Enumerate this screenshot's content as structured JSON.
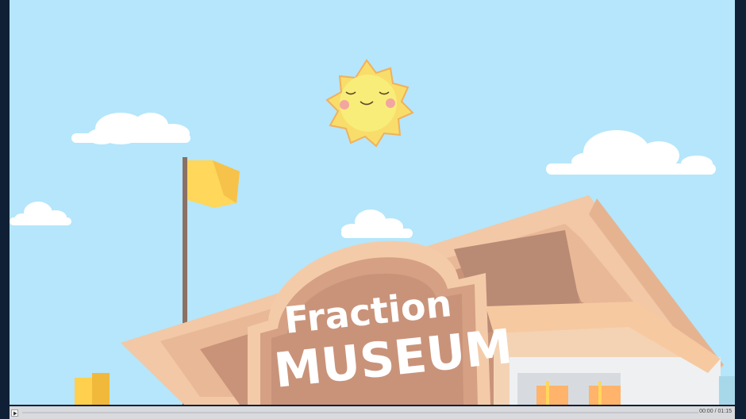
{
  "video": {
    "museum_sign": {
      "line1": "Fraction",
      "line2": "MUSEUM"
    }
  },
  "player": {
    "current_time": "00:00",
    "time_separator": "/",
    "duration": "01:15",
    "progress_fraction": 0
  },
  "colors": {
    "sky": "#b5e6fb",
    "frame": "#0f2036",
    "building_light": "#f3c9a7",
    "building_dark": "#d8a98b",
    "sun": "#f7e36b",
    "flag": "#ffd75a",
    "controls_bar": "#d9dadd"
  },
  "icons": {
    "play": "play-icon"
  }
}
